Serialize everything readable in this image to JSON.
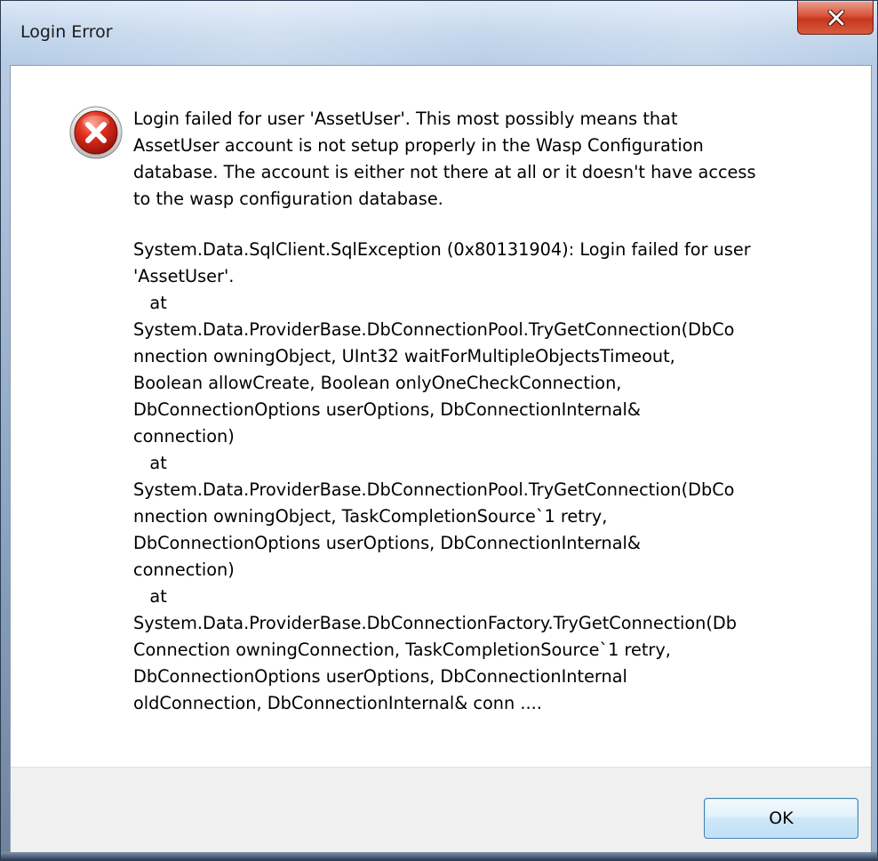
{
  "window": {
    "title": "Login Error",
    "close_glyph": "×"
  },
  "icon": {
    "name": "error-icon",
    "color": "#d32f2f"
  },
  "message": {
    "lines": [
      "Login failed for user 'AssetUser'. This most possibly means that",
      "AssetUser account is not setup properly in the Wasp Configuration",
      "database. The account is either not there at all or it doesn't have access",
      "to the wasp configuration database."
    ],
    "exception_lines": [
      "System.Data.SqlClient.SqlException (0x80131904): Login failed for user",
      "'AssetUser'.",
      "   at",
      "System.Data.ProviderBase.DbConnectionPool.TryGetConnection(DbCo",
      "nnection owningObject, UInt32 waitForMultipleObjectsTimeout,",
      "Boolean allowCreate, Boolean onlyOneCheckConnection,",
      "DbConnectionOptions userOptions, DbConnectionInternal&",
      "connection)",
      "   at",
      "System.Data.ProviderBase.DbConnectionPool.TryGetConnection(DbCo",
      "nnection owningObject, TaskCompletionSource`1 retry,",
      "DbConnectionOptions userOptions, DbConnectionInternal&",
      "connection)",
      "   at",
      "System.Data.ProviderBase.DbConnectionFactory.TryGetConnection(Db",
      "Connection owningConnection, TaskCompletionSource`1 retry,",
      "DbConnectionOptions userOptions, DbConnectionInternal",
      "oldConnection, DbConnectionInternal& conn ...."
    ]
  },
  "buttons": {
    "ok_label": "OK"
  }
}
